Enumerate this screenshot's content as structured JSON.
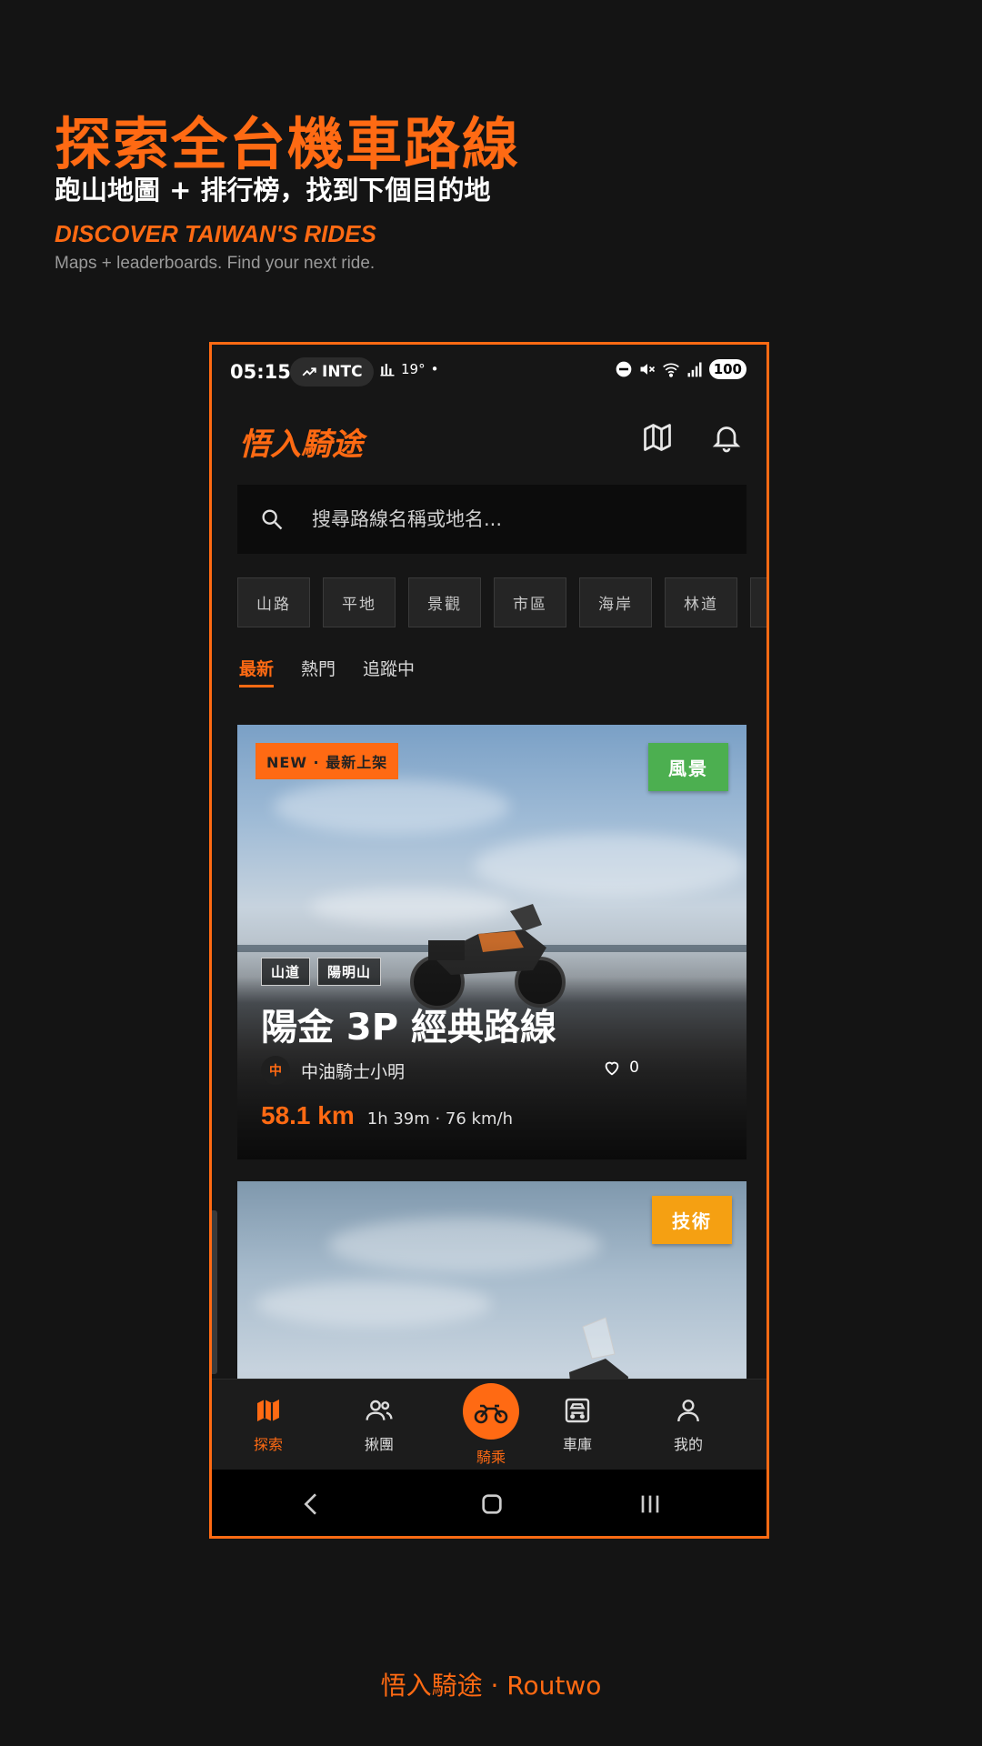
{
  "promo": {
    "title_zh": "探索全台機車路線",
    "subtitle_zh": "跑山地圖 + 排行榜，找到下個目的地",
    "title_en": "DISCOVER TAIWAN'S RIDES",
    "subtitle_en": "Maps + leaderboards. Find your next ride."
  },
  "status_bar": {
    "time": "05:15",
    "ticker": "INTC",
    "temp": "19°",
    "battery": "100"
  },
  "app": {
    "name": "悟入騎途",
    "icons": [
      "map-icon",
      "bell-icon"
    ]
  },
  "search": {
    "placeholder": "搜尋路線名稱或地名..."
  },
  "chips": [
    "山路",
    "平地",
    "景觀",
    "市區",
    "海岸",
    "林道"
  ],
  "tabs": {
    "items": [
      "最新",
      "熱門",
      "追蹤中"
    ],
    "active": "最新"
  },
  "routes": [
    {
      "badge_new": "NEW · 最新上架",
      "category": "風景",
      "category_color": "#4caf50",
      "tags": [
        "山道",
        "陽明山"
      ],
      "title": "陽金 3P 經典路線",
      "author_initial": "中",
      "author": "中油騎士小明",
      "likes": "0",
      "distance": "58.1 km",
      "duration_speed": "1h 39m · 76 km/h"
    },
    {
      "category": "技術",
      "category_color": "#f5a012"
    }
  ],
  "bottom_nav": {
    "explore": "探索",
    "group": "揪團",
    "ride": "騎乘",
    "garage": "車庫",
    "me": "我的"
  },
  "footer": "悟入騎途 · Routwo",
  "colors": {
    "accent": "#ff6a13",
    "background": "#141414"
  }
}
